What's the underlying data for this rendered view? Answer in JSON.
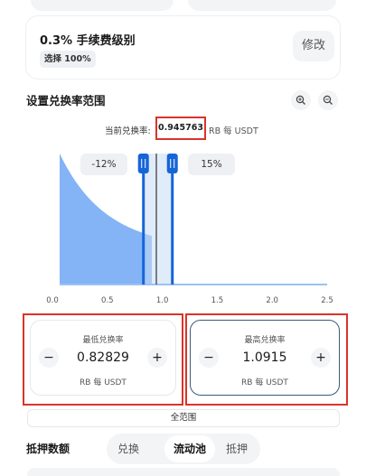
{
  "fee": {
    "title": "0.3% 手续费级别",
    "badge": "选择 100%",
    "edit_label": "修改"
  },
  "range": {
    "title": "设置兑换率范围",
    "zoom_in_icon": "zoom-in-icon",
    "zoom_out_icon": "zoom-out-icon",
    "current_rate_label": "当前兑换率:",
    "current_rate_value": "0.945763",
    "current_rate_unit": "RB 每 USDT",
    "low_pct": "-12%",
    "high_pct": "15%"
  },
  "chart_data": {
    "type": "area",
    "x_ticks": [
      "0.0",
      "0.5",
      "1.0",
      "1.5",
      "2.0",
      "2.5"
    ],
    "xlim": [
      0,
      2.5
    ],
    "current_price": 0.945763,
    "range_min": 0.82829,
    "range_max": 1.0915,
    "fill_color": "#6ea6f5",
    "handle_color": "#1565d8"
  },
  "min_price": {
    "title": "最低兑换率",
    "value": "0.82829",
    "unit": "RB 每 USDT",
    "minus": "−",
    "plus": "+"
  },
  "max_price": {
    "title": "最高兑换率",
    "value": "1.0915",
    "unit": "RB 每 USDT",
    "minus": "−",
    "plus": "+"
  },
  "full_range_label": "全范围",
  "deposit": {
    "title": "抵押数额"
  },
  "bottom_tabs": [
    {
      "label": "兑换"
    },
    {
      "label": "流动池"
    },
    {
      "label": "抵押"
    }
  ]
}
